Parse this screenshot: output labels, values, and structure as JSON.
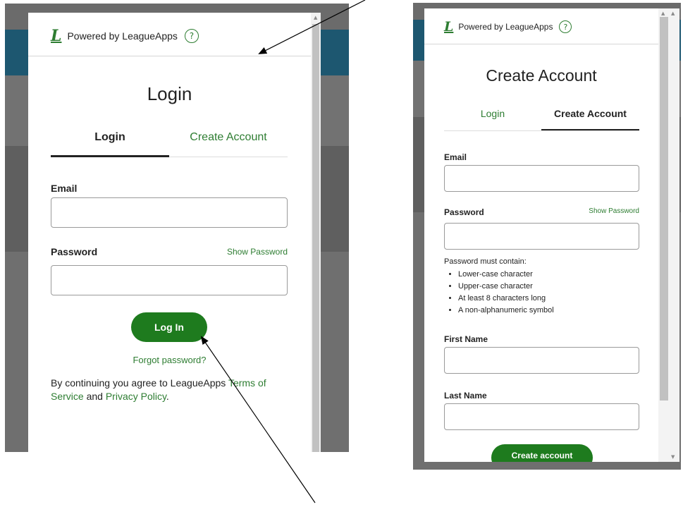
{
  "left_modal": {
    "powered_by": "Powered by LeagueApps",
    "help_symbol": "?",
    "logo_glyph": "L",
    "title": "Login",
    "tabs": [
      {
        "label": "Login",
        "active": true
      },
      {
        "label": "Create Account",
        "active": false
      }
    ],
    "email_label": "Email",
    "email_value": "",
    "password_label": "Password",
    "show_password": "Show Password",
    "password_value": "",
    "login_button": "Log In",
    "forgot_password": "Forgot password?",
    "consent_prefix": "By continuing you agree to LeagueApps ",
    "terms_link": "Terms of Service",
    "consent_and": " and ",
    "privacy_link": "Privacy Policy",
    "consent_suffix": "."
  },
  "right_modal": {
    "powered_by": "Powered by LeagueApps",
    "help_symbol": "?",
    "logo_glyph": "L",
    "title": "Create Account",
    "tabs": [
      {
        "label": "Login",
        "active": false
      },
      {
        "label": "Create Account",
        "active": true
      }
    ],
    "email_label": "Email",
    "password_label": "Password",
    "show_password": "Show Password",
    "password_rules_heading": "Password must contain:",
    "password_rules": [
      "Lower-case character",
      "Upper-case character",
      "At least 8 characters long",
      "A non-alphanumeric symbol"
    ],
    "first_name_label": "First Name",
    "last_name_label": "Last Name",
    "create_button": "Create account"
  },
  "colors": {
    "brand_green": "#2e7d32",
    "button_green": "#1e7b1e",
    "header_blue": "#1d5770",
    "backdrop_gray": "#6f6f6f"
  }
}
